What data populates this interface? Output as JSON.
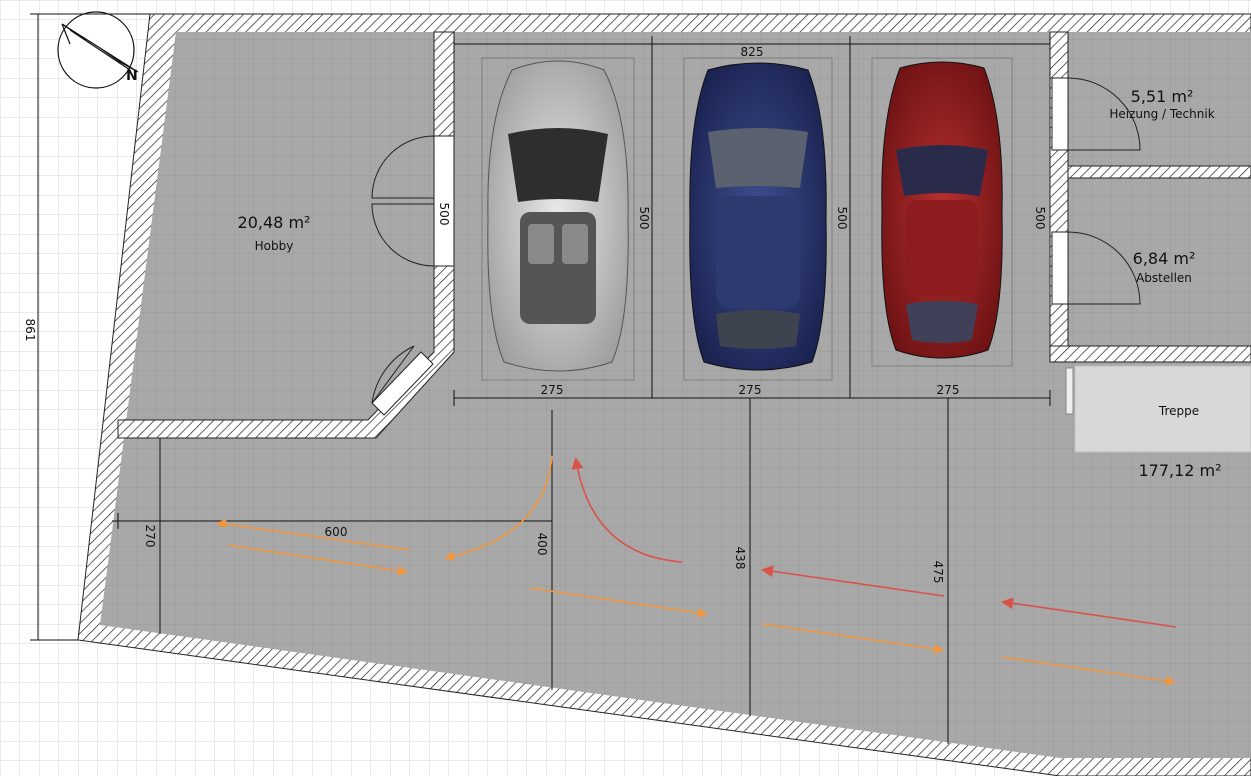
{
  "rooms": {
    "hobby": {
      "area": "20,48 m²",
      "name": "Hobby"
    },
    "heizung": {
      "area": "5,51 m²",
      "name": "Heizung / Technik"
    },
    "abstellen": {
      "area": "6,84 m²",
      "name": "Abstellen"
    },
    "treppe": {
      "name": "Treppe"
    },
    "garage": {
      "area": "177,12 m²"
    }
  },
  "dimensions": {
    "total_width": "825",
    "total_depth": "861",
    "door_hobby": "500",
    "bay_depth_1": "500",
    "bay_depth_2": "500",
    "bay_depth_3": "500",
    "bay_width_1": "275",
    "bay_width_2": "275",
    "bay_width_3": "275",
    "lane_length": "600",
    "lane_left_depth": "270",
    "lane_depth_1": "400",
    "lane_depth_2": "438",
    "lane_depth_3": "475"
  },
  "colors": {
    "floor": "#a7a7a7",
    "grid": "#cdcdcd",
    "arrow_orange": "#f0963c",
    "arrow_red": "#d9534a",
    "car_silver": "#c9c9c9",
    "car_blue": "#28356a",
    "car_red": "#9a1f22"
  },
  "icons": {
    "compass": "compass-icon"
  }
}
